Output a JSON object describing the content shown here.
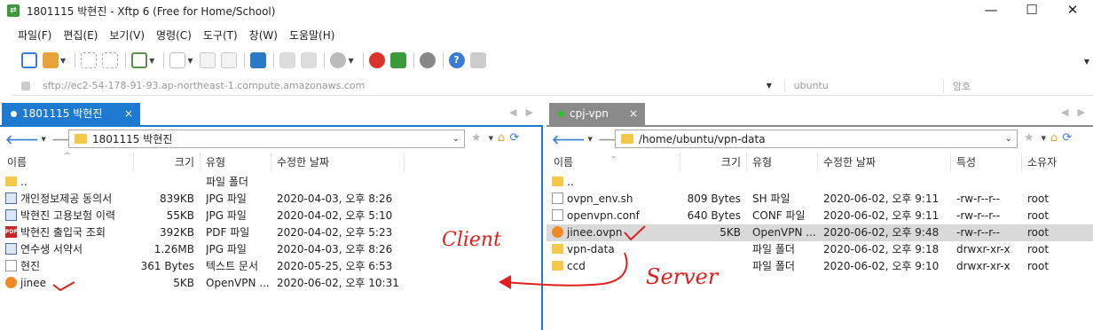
{
  "window": {
    "title": "1801115 박현진 - Xftp 6 (Free for Home/School)",
    "minimize": "—",
    "maximize": "☐",
    "close": "✕"
  },
  "menu": [
    "파일(F)",
    "편집(E)",
    "보기(V)",
    "명령(C)",
    "도구(T)",
    "창(W)",
    "도움말(H)"
  ],
  "address": {
    "url": "sftp://ec2-54-178-91-93.ap-northeast-1.compute.amazonaws.com",
    "user": "ubuntu",
    "password_placeholder": "암호"
  },
  "left": {
    "tab_label": "1801115 박현진",
    "tab_close": "×",
    "path": "1801115 박현진",
    "columns": [
      "이름",
      "크기",
      "유형",
      "수정한 날짜"
    ],
    "rows": [
      {
        "icon": "folder",
        "name": "..",
        "size": "",
        "type": "파일 폴더",
        "date": ""
      },
      {
        "icon": "jpg",
        "name": "개인정보제공 동의서",
        "size": "839KB",
        "type": "JPG 파일",
        "date": "2020-04-03, 오후 8:26"
      },
      {
        "icon": "jpg",
        "name": "박현진 고용보험 이력",
        "size": "55KB",
        "type": "JPG 파일",
        "date": "2020-04-02, 오후 5:10"
      },
      {
        "icon": "pdf",
        "name": "박현진 출입국 조회",
        "size": "392KB",
        "type": "PDF 파일",
        "date": "2020-04-02, 오후 5:23"
      },
      {
        "icon": "jpg",
        "name": "연수생 서약서",
        "size": "1.26MB",
        "type": "JPG 파일",
        "date": "2020-04-03, 오후 8:26"
      },
      {
        "icon": "file",
        "name": "현진",
        "size": "361 Bytes",
        "type": "텍스트 문서",
        "date": "2020-05-25, 오후 6:53"
      },
      {
        "icon": "ovpn",
        "name": "jinee",
        "size": "5KB",
        "type": "OpenVPN ...",
        "date": "2020-06-02, 오후 10:31"
      }
    ]
  },
  "right": {
    "tab_label": "cpj-vpn",
    "tab_close": "×",
    "path": "/home/ubuntu/vpn-data",
    "columns": [
      "이름",
      "크기",
      "유형",
      "수정한 날짜",
      "특성",
      "소유자"
    ],
    "rows": [
      {
        "icon": "folder",
        "name": "..",
        "size": "",
        "type": "",
        "date": "",
        "attr": "",
        "owner": ""
      },
      {
        "icon": "file",
        "name": "ovpn_env.sh",
        "size": "809 Bytes",
        "type": "SH 파일",
        "date": "2020-06-02, 오후 9:11",
        "attr": "-rw-r--r--",
        "owner": "root"
      },
      {
        "icon": "file",
        "name": "openvpn.conf",
        "size": "640 Bytes",
        "type": "CONF 파일",
        "date": "2020-06-02, 오후 9:11",
        "attr": "-rw-r--r--",
        "owner": "root"
      },
      {
        "icon": "ovpn",
        "name": "jinee.ovpn",
        "size": "5KB",
        "type": "OpenVPN ...",
        "date": "2020-06-02, 오후 9:48",
        "attr": "-rw-r--r--",
        "owner": "root"
      },
      {
        "icon": "folder",
        "name": "vpn-data",
        "size": "",
        "type": "파일 폴더",
        "date": "2020-06-02, 오후 9:18",
        "attr": "drwxr-xr-x",
        "owner": "root"
      },
      {
        "icon": "folder",
        "name": "ccd",
        "size": "",
        "type": "파일 폴더",
        "date": "2020-06-02, 오후 9:10",
        "attr": "drwxr-xr-x",
        "owner": "root"
      }
    ]
  },
  "annotations": {
    "client": "Client",
    "server": "Server"
  },
  "colors": {
    "active_tab": "#1e7ad1",
    "inactive_tab": "#8a8a8a",
    "annotation": "#e0201c",
    "connected_dot": "#2ec22e"
  }
}
